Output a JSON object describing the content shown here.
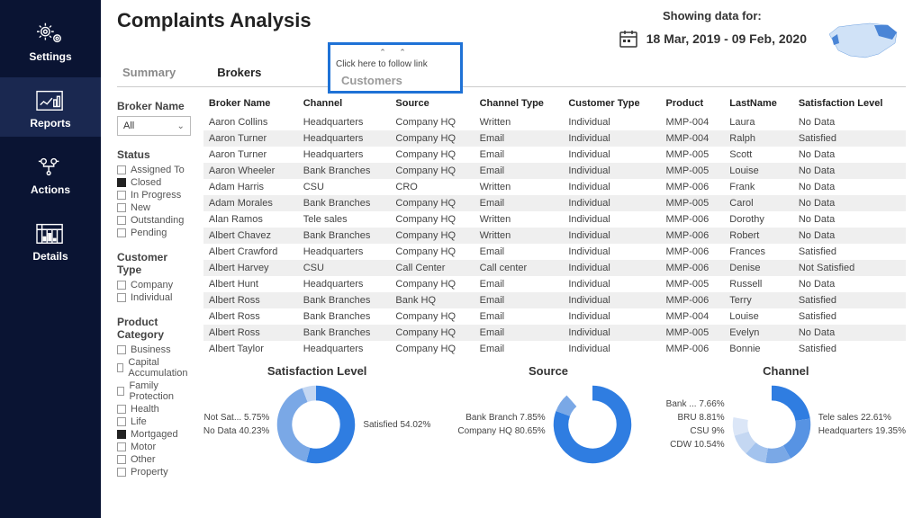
{
  "page_title": "Complaints Analysis",
  "nav": [
    {
      "id": "settings",
      "label": "Settings"
    },
    {
      "id": "reports",
      "label": "Reports"
    },
    {
      "id": "actions",
      "label": "Actions"
    },
    {
      "id": "details",
      "label": "Details"
    }
  ],
  "active_nav": "reports",
  "header": {
    "showing_label": "Showing data for:",
    "date_range": "18 Mar, 2019 - 09 Feb, 2020"
  },
  "tabs": [
    "Summary",
    "Brokers",
    "Customers"
  ],
  "active_tab": "Brokers",
  "tooltip": "Click here to follow link",
  "filters": {
    "broker_name": {
      "title": "Broker Name",
      "value": "All"
    },
    "status": {
      "title": "Status",
      "items": [
        {
          "label": "Assigned To",
          "checked": false
        },
        {
          "label": "Closed",
          "checked": true
        },
        {
          "label": "In Progress",
          "checked": false
        },
        {
          "label": "New",
          "checked": false
        },
        {
          "label": "Outstanding",
          "checked": false
        },
        {
          "label": "Pending",
          "checked": false
        }
      ]
    },
    "customer_type": {
      "title": "Customer Type",
      "items": [
        {
          "label": "Company",
          "checked": false
        },
        {
          "label": "Individual",
          "checked": false
        }
      ]
    },
    "product_category": {
      "title": "Product Category",
      "items": [
        {
          "label": "Business",
          "checked": false
        },
        {
          "label": "Capital Accumulation",
          "checked": false
        },
        {
          "label": "Family Protection",
          "checked": false
        },
        {
          "label": "Health",
          "checked": false
        },
        {
          "label": "Life",
          "checked": false
        },
        {
          "label": "Mortgaged",
          "checked": true
        },
        {
          "label": "Motor",
          "checked": false
        },
        {
          "label": "Other",
          "checked": false
        },
        {
          "label": "Property",
          "checked": false
        }
      ]
    }
  },
  "table": {
    "columns": [
      "Broker Name",
      "Channel",
      "Source",
      "Channel Type",
      "Customer Type",
      "Product",
      "LastName",
      "Satisfaction Level"
    ],
    "rows": [
      [
        "Aaron Collins",
        "Headquarters",
        "Company HQ",
        "Written",
        "Individual",
        "MMP-004",
        "Laura",
        "No Data"
      ],
      [
        "Aaron Turner",
        "Headquarters",
        "Company HQ",
        "Email",
        "Individual",
        "MMP-004",
        "Ralph",
        "Satisfied"
      ],
      [
        "Aaron Turner",
        "Headquarters",
        "Company HQ",
        "Email",
        "Individual",
        "MMP-005",
        "Scott",
        "No Data"
      ],
      [
        "Aaron Wheeler",
        "Bank Branches",
        "Company HQ",
        "Email",
        "Individual",
        "MMP-005",
        "Louise",
        "No Data"
      ],
      [
        "Adam Harris",
        "CSU",
        "CRO",
        "Written",
        "Individual",
        "MMP-006",
        "Frank",
        "No Data"
      ],
      [
        "Adam Morales",
        "Bank Branches",
        "Company HQ",
        "Email",
        "Individual",
        "MMP-005",
        "Carol",
        "No Data"
      ],
      [
        "Alan Ramos",
        "Tele sales",
        "Company HQ",
        "Written",
        "Individual",
        "MMP-006",
        "Dorothy",
        "No Data"
      ],
      [
        "Albert Chavez",
        "Bank Branches",
        "Company HQ",
        "Written",
        "Individual",
        "MMP-006",
        "Robert",
        "No Data"
      ],
      [
        "Albert Crawford",
        "Headquarters",
        "Company HQ",
        "Email",
        "Individual",
        "MMP-006",
        "Frances",
        "Satisfied"
      ],
      [
        "Albert Harvey",
        "CSU",
        "Call Center",
        "Call center",
        "Individual",
        "MMP-006",
        "Denise",
        "Not Satisfied"
      ],
      [
        "Albert Hunt",
        "Headquarters",
        "Company HQ",
        "Email",
        "Individual",
        "MMP-005",
        "Russell",
        "No Data"
      ],
      [
        "Albert Ross",
        "Bank Branches",
        "Bank HQ",
        "Email",
        "Individual",
        "MMP-006",
        "Terry",
        "Satisfied"
      ],
      [
        "Albert Ross",
        "Bank Branches",
        "Company HQ",
        "Email",
        "Individual",
        "MMP-004",
        "Louise",
        "Satisfied"
      ],
      [
        "Albert Ross",
        "Bank Branches",
        "Company HQ",
        "Email",
        "Individual",
        "MMP-005",
        "Evelyn",
        "No Data"
      ],
      [
        "Albert Taylor",
        "Headquarters",
        "Company HQ",
        "Email",
        "Individual",
        "MMP-006",
        "Bonnie",
        "Satisfied"
      ]
    ]
  },
  "chart_data": [
    {
      "type": "pie",
      "title": "Satisfaction Level",
      "series": [
        {
          "name": "Satisfied",
          "value": 54.02,
          "color": "#2f7de1"
        },
        {
          "name": "No Data",
          "value": 40.23,
          "color": "#7aa8e6"
        },
        {
          "name": "Not Sat...",
          "value": 5.75,
          "color": "#c4d7f2"
        }
      ],
      "labels_left": [
        "Not Sat... 5.75%",
        "No Data 40.23%"
      ],
      "labels_right": [
        "Satisfied 54.02%"
      ]
    },
    {
      "type": "pie",
      "title": "Source",
      "series": [
        {
          "name": "Company HQ",
          "value": 80.65,
          "color": "#2f7de1"
        },
        {
          "name": "Bank Branch",
          "value": 7.85,
          "color": "#7aa8e6"
        }
      ],
      "labels_left": [
        "Bank Branch 7.85%",
        "Company HQ 80.65%"
      ],
      "labels_right": []
    },
    {
      "type": "pie",
      "title": "Channel",
      "series": [
        {
          "name": "Tele sales",
          "value": 22.61,
          "color": "#2f7de1"
        },
        {
          "name": "Headquarters",
          "value": 19.35,
          "color": "#5793e3"
        },
        {
          "name": "CDW",
          "value": 10.54,
          "color": "#7aa8e6"
        },
        {
          "name": "CSU",
          "value": 9.0,
          "color": "#a3c3ee"
        },
        {
          "name": "BRU",
          "value": 8.81,
          "color": "#c4d7f2"
        },
        {
          "name": "Bank ...",
          "value": 7.66,
          "color": "#dbe6f7"
        }
      ],
      "labels_left": [
        "Bank ... 7.66%",
        "BRU 8.81%",
        "CSU 9%",
        "CDW 10.54%"
      ],
      "labels_right": [
        "Tele sales 22.61%",
        "Headquarters 19.35%"
      ]
    }
  ]
}
